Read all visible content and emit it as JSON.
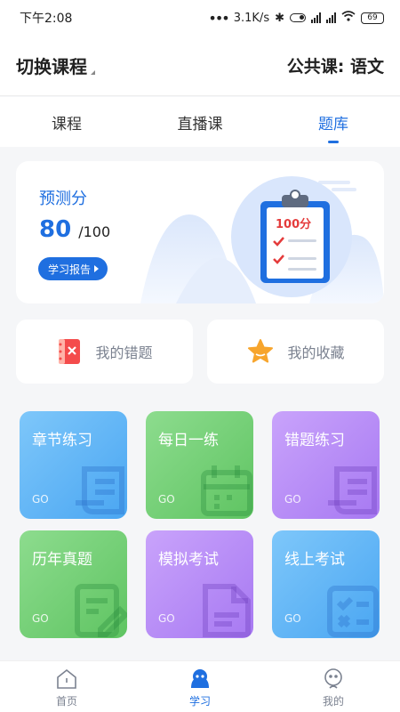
{
  "status": {
    "time": "下午2:08",
    "net_speed": "3.1K/s",
    "battery": "69"
  },
  "header": {
    "switch_label": "切换课程",
    "course_label": "公共课: 语文"
  },
  "tabs": [
    {
      "label": "课程",
      "active": false
    },
    {
      "label": "直播课",
      "active": false
    },
    {
      "label": "题库",
      "active": true
    }
  ],
  "score": {
    "title": "预测分",
    "value": "80",
    "max": "/100",
    "report_label": "学习报告",
    "badge_text": "100分"
  },
  "quick": {
    "wrong_label": "我的错题",
    "fav_label": "我的收藏"
  },
  "tiles": [
    {
      "label": "章节练习",
      "go": "GO",
      "color": "#5cb6f6"
    },
    {
      "label": "每日一练",
      "go": "GO",
      "color": "#79d67a"
    },
    {
      "label": "错题练习",
      "go": "GO",
      "color": "#b68af5"
    },
    {
      "label": "历年真题",
      "go": "GO",
      "color": "#7ad67b"
    },
    {
      "label": "模拟考试",
      "go": "GO",
      "color": "#b58af3"
    },
    {
      "label": "线上考试",
      "go": "GO",
      "color": "#5ab5f5"
    }
  ],
  "nav": [
    {
      "label": "首页",
      "icon": "home-icon",
      "active": false
    },
    {
      "label": "学习",
      "icon": "study-icon",
      "active": true
    },
    {
      "label": "我的",
      "icon": "profile-icon",
      "active": false
    }
  ],
  "colors": {
    "accent": "#1f6fe0",
    "muted": "#7b8290"
  }
}
